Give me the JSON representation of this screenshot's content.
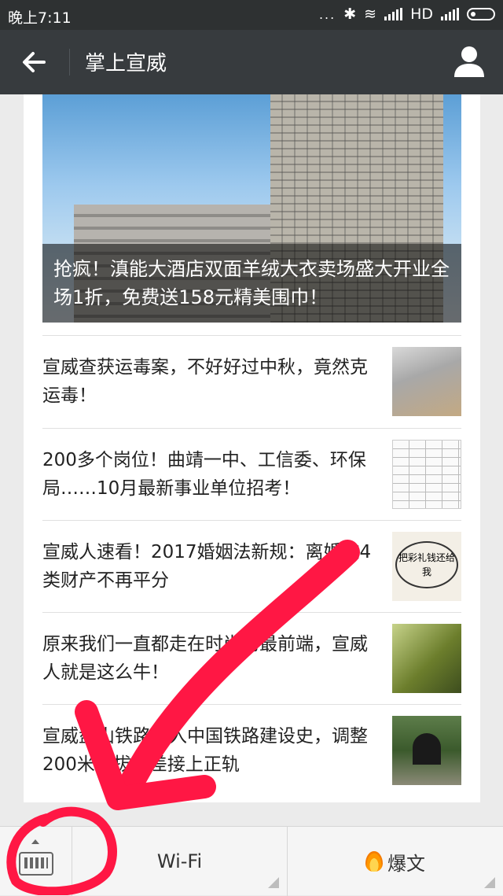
{
  "status_bar": {
    "time": "晚上7:11",
    "dots": "...",
    "network": "HD"
  },
  "header": {
    "title": "掌上宣威",
    "back_icon": "arrow-left-icon",
    "profile_icon": "person-icon"
  },
  "feed": {
    "hero": {
      "caption": "抢疯！滇能大酒店双面羊绒大衣卖场盛大开业全场1折，免费送158元精美围巾！"
    },
    "items": [
      {
        "title": "宣威查获运毒案，不好好过中秋，竟然克运毒！"
      },
      {
        "title": "200多个岗位！曲靖一中、工信委、环保局……10月最新事业单位招考！"
      },
      {
        "title": "宣威人速看！2017婚姻法新规：离婚这4类财产不再平分",
        "thumb_text": "把彩礼钱还给我"
      },
      {
        "title": "原来我们一直都走在时尚的最前端，宣威人就是这么牛！"
      },
      {
        "title": "宣威盘山铁路载入中国铁路建设史，调整200米海拔落差接上正轨"
      }
    ]
  },
  "bottom_bar": {
    "keyboard_icon": "keyboard-icon",
    "menu_wifi": "Wi-Fi",
    "menu_hot": "爆文",
    "hot_icon": "flame-icon"
  },
  "colors": {
    "header_bg": "#373b3e",
    "status_bg": "#2e3132",
    "annotation": "#ff1744"
  }
}
